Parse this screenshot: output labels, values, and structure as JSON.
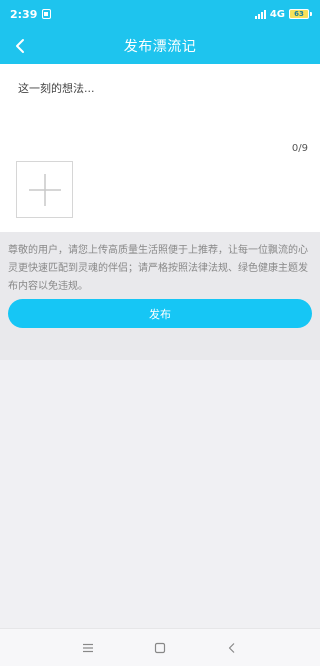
{
  "status_bar": {
    "time": "2:39",
    "network": "4G",
    "battery": "63"
  },
  "nav": {
    "title": "发布漂流记",
    "back_icon": "chevron-left-icon"
  },
  "post": {
    "placeholder": "这一刻的想法...",
    "char_count": "0/9",
    "add_photo_icon": "plus-icon"
  },
  "notice": {
    "text": "尊敬的用户，请您上传高质量生活照便于上推荐，让每一位飘流的心灵更快速匹配到灵魂的伴侣；请严格按照法律法规、绿色健康主题发布内容以免违规。"
  },
  "actions": {
    "publish_label": "发布"
  },
  "colors": {
    "accent": "#1ec4ee",
    "button": "#16c6f5"
  },
  "system_nav": {
    "menu_icon": "menu-icon",
    "home_icon": "square-icon",
    "back_icon": "back-triangle-icon"
  }
}
